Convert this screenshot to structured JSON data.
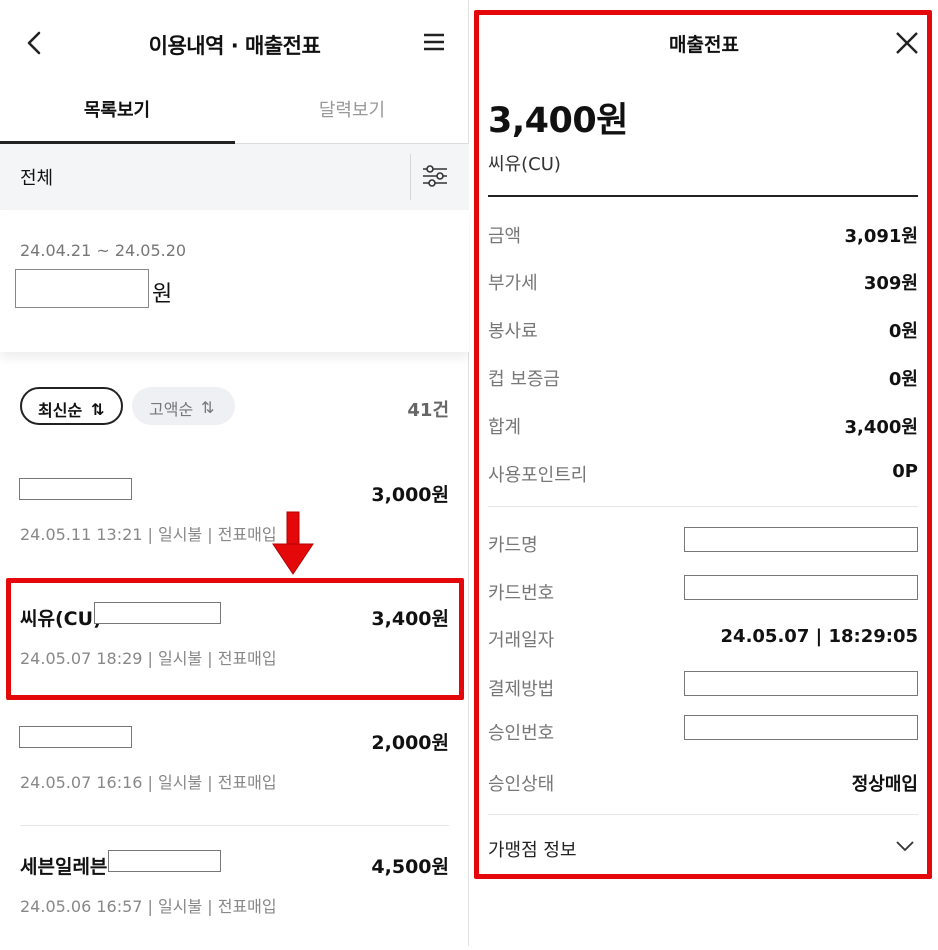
{
  "left": {
    "header": {
      "title": "이용내역 · 매출전표"
    },
    "tabs": [
      {
        "label": "목록보기"
      },
      {
        "label": "달력보기"
      }
    ],
    "filter": {
      "label": "전체"
    },
    "summary": {
      "date_range": "24.04.21 ~ 24.05.20",
      "unit": "원"
    },
    "sort": {
      "active": "최신순",
      "inactive": "고액순",
      "arrow": "⇅",
      "count": "41건"
    },
    "transactions": [
      {
        "merchant": "",
        "amount": "3,000원",
        "meta": "24.05.11 13:21 | 일시불 | 전표매입"
      },
      {
        "merchant": "씨유(CU)",
        "amount": "3,400원",
        "meta": "24.05.07 18:29 | 일시불 | 전표매입"
      },
      {
        "merchant": "",
        "amount": "2,000원",
        "meta": "24.05.07 16:16 | 일시불 | 전표매입"
      },
      {
        "merchant": "세븐일레븐",
        "amount": "4,500원",
        "meta": "24.05.06 16:57 | 일시불 | 전표매입"
      }
    ]
  },
  "right": {
    "title": "매출전표",
    "total": "3,400원",
    "merchant": "씨유(CU)",
    "rows": [
      {
        "label": "금액",
        "value": "3,091원"
      },
      {
        "label": "부가세",
        "value": "309원"
      },
      {
        "label": "봉사료",
        "value": "0원"
      },
      {
        "label": "컵 보증금",
        "value": "0원"
      },
      {
        "label": "합계",
        "value": "3,400원"
      },
      {
        "label": "사용포인트리",
        "value": "0P"
      }
    ],
    "details": [
      {
        "label": "카드명",
        "value": ""
      },
      {
        "label": "카드번호",
        "value": ""
      },
      {
        "label": "거래일자",
        "value": "24.05.07 | 18:29:05"
      },
      {
        "label": "결제방법",
        "value": ""
      },
      {
        "label": "승인번호",
        "value": ""
      },
      {
        "label": "승인상태",
        "value": "정상매입"
      }
    ],
    "footer": "가맹점 정보"
  },
  "colors": {
    "highlight": "#e5080a",
    "muted": "#777777",
    "filter_bg": "#f4f5f7"
  }
}
